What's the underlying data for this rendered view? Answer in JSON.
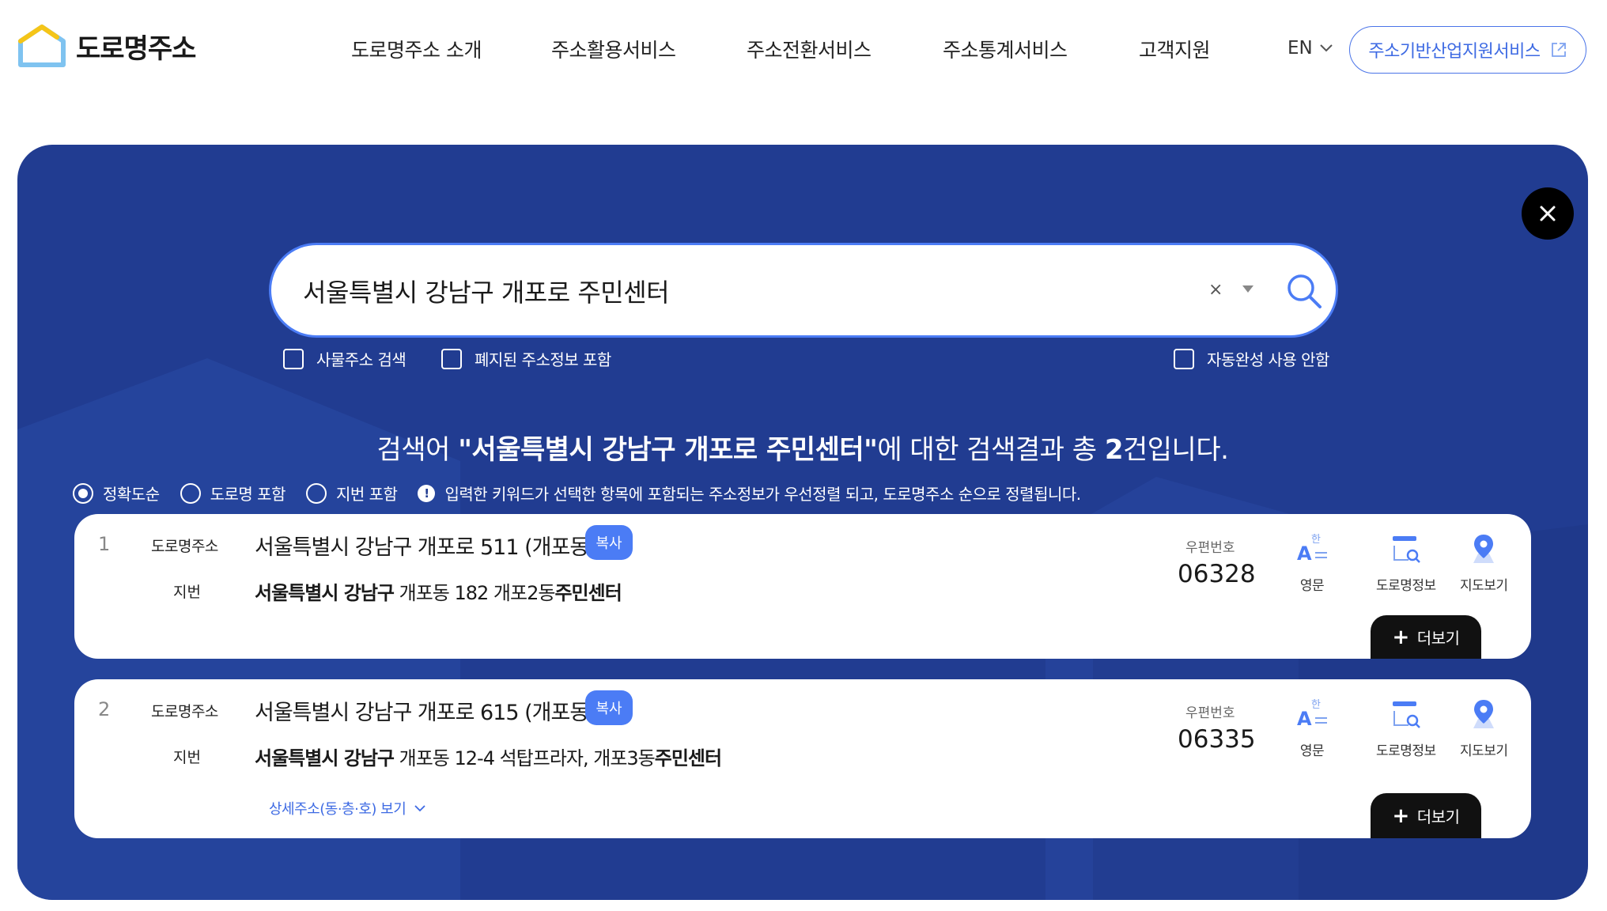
{
  "header": {
    "logo_text": "도로명주소",
    "nav": [
      {
        "label": "도로명주소 소개"
      },
      {
        "label": "주소활용서비스"
      },
      {
        "label": "주소전환서비스"
      },
      {
        "label": "주소통계서비스"
      },
      {
        "label": "고객지원"
      }
    ],
    "lang": "EN",
    "external_button": "주소기반산업지원서비스"
  },
  "search": {
    "query": "서울특별시 강남구 개포로 주민센터",
    "clear": "×",
    "options": {
      "building_search": "사물주소 검색",
      "abolished": "폐지된 주소정보 포함",
      "autocomplete_off": "자동완성 사용 안함"
    }
  },
  "result_summary": {
    "prefix": "검색어 ",
    "query_quoted": "\"서울특별시 강남구 개포로 주민센터\"",
    "middle": "에 대한 검색결과 총 ",
    "count": "2",
    "suffix": "건입니다."
  },
  "sort": {
    "options": [
      {
        "label": "정확도순",
        "selected": true
      },
      {
        "label": "도로명 포함",
        "selected": false
      },
      {
        "label": "지번 포함",
        "selected": false
      }
    ],
    "info": "입력한 키워드가 선택한 항목에 포함되는 주소정보가 우선정렬 되고, 도로명주소 순으로 정렬됩니다."
  },
  "labels": {
    "road": "도로명주소",
    "jibun": "지번",
    "copy": "복사",
    "zip": "우편번호",
    "english": "영문",
    "road_info": "도로명정보",
    "map": "지도보기",
    "more": "더보기",
    "detail": "상세주소(동·층·호) 보기"
  },
  "results": [
    {
      "num": "1",
      "road_address": "서울특별시 강남구 개포로 511 (개포동)",
      "jibun_prefix": "서울특별시 강남구",
      "jibun_middle": " 개포동 182 개포2동",
      "jibun_keyword": "주민센터",
      "zip": "06328"
    },
    {
      "num": "2",
      "road_address": "서울특별시 강남구 개포로 615 (개포동)",
      "jibun_prefix": "서울특별시 강남구",
      "jibun_middle": " 개포동 12-4 석탑프라자, 개포3동",
      "jibun_keyword": "주민센터",
      "zip": "06335"
    }
  ],
  "colors": {
    "panel": "#213c91",
    "accent": "#4b7cf5",
    "button_dark": "#111111"
  }
}
